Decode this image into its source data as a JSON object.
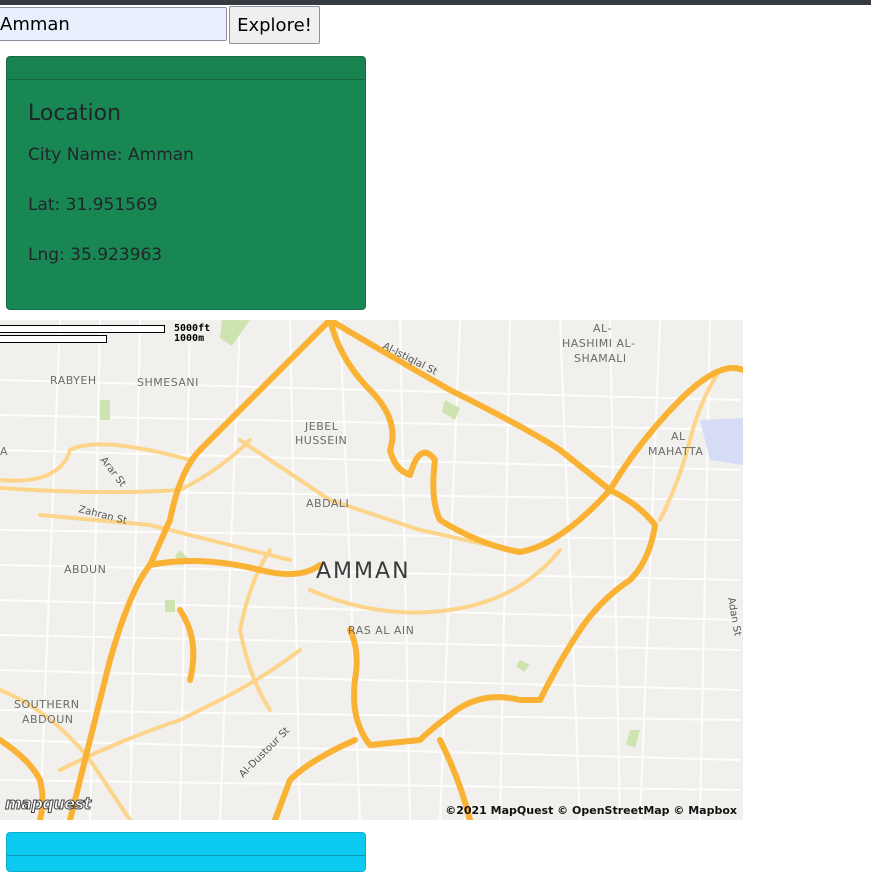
{
  "search": {
    "value": "Amman",
    "button_label": "Explore!"
  },
  "location_card": {
    "title": "Location",
    "city_line": "City Name: Amman",
    "lat_line": "Lat: 31.951569",
    "lng_line": "Lng: 35.923963",
    "color": "#198754"
  },
  "map": {
    "scale_ft": "5000ft",
    "scale_m": "1000m",
    "city_label": "AMMAN",
    "district_labels": {
      "rabyeh": "RABYEH",
      "shmesani": "SHMESANI",
      "jebel_1": "JEBEL",
      "jebel_2": "HUSSEIN",
      "abdali": "ABDALI",
      "abdun": "ABDUN",
      "ras_al_ain": "RAS AL AIN",
      "southern_1": "SOUTHERN",
      "southern_2": "ABDOUN",
      "hashimi_1": "AL-",
      "hashimi_2": "HASHIMI AL-",
      "hashimi_3": "SHAMALI",
      "mahatta_1": "AL",
      "mahatta_2": "MAHATTA",
      "edge_a": "A"
    },
    "street_labels": {
      "istiqlal": "Al-Istiqlal St",
      "arar": "Arar St",
      "zahran": "Zahran St",
      "dustour": "Al-Dustour St",
      "adan": "Adan St"
    },
    "attribution": "©2021 MapQuest © OpenStreetMap © Mapbox",
    "logo_text": "mapquest",
    "road_color": "#f9b233"
  },
  "second_card": {
    "color": "#0dcaf0"
  }
}
